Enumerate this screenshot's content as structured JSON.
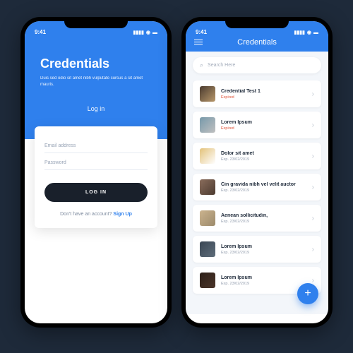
{
  "status": {
    "time": "9:41"
  },
  "login": {
    "title": "Credentials",
    "subtitle": "Duis sed odio sit amet nibh vulputate cursus a sit amet mauris.",
    "tab_label": "Log in",
    "email_placeholder": "Email address",
    "password_placeholder": "Password",
    "button": "LOG IN",
    "footer_text": "Don't have an account? ",
    "signup": "Sign Up"
  },
  "list": {
    "header_title": "Credentials",
    "search_placeholder": "Search Here",
    "fab": "+",
    "items": [
      {
        "title": "Credential Test 1",
        "sub": "Expired",
        "expired": true
      },
      {
        "title": "Lorem Ipsum",
        "sub": "Expired",
        "expired": true
      },
      {
        "title": "Dolor sit amet",
        "sub": "Exp. 23/02/2019",
        "expired": false
      },
      {
        "title": "Cin gravida nibh vel velit auctor",
        "sub": "Exp. 23/02/2019",
        "expired": false
      },
      {
        "title": "Aenean sollicitudin,",
        "sub": "Exp. 23/02/2019",
        "expired": false
      },
      {
        "title": "Lorem Ipsum",
        "sub": "Exp. 23/02/2019",
        "expired": false
      },
      {
        "title": "Lorem Ipsum",
        "sub": "Exp. 23/02/2019",
        "expired": false
      }
    ]
  }
}
